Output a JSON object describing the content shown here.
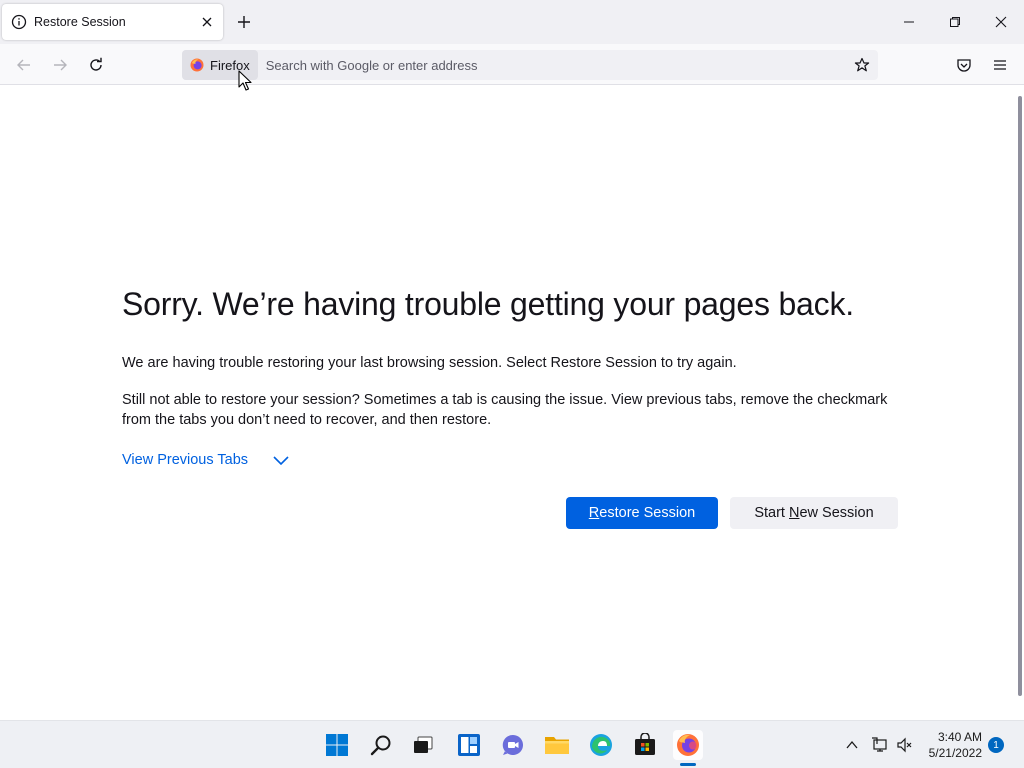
{
  "tab": {
    "title": "Restore Session"
  },
  "urlbar": {
    "identity_label": "Firefox",
    "placeholder": "Search with Google or enter address"
  },
  "content": {
    "title": "Sorry. We’re having trouble getting your pages back.",
    "para1": "We are having trouble restoring your last browsing session. Select Restore Session to try again.",
    "para2": "Still not able to restore your session? Sometimes a tab is causing the issue. View previous tabs, remove the checkmark from the tabs you don’t need to recover, and then restore.",
    "view_previous": "View Previous Tabs",
    "restore_btn": {
      "accesskey": "R",
      "rest": "estore Session"
    },
    "new_session_btn": {
      "before": "Start ",
      "accesskey": "N",
      "after": "ew Session"
    }
  },
  "taskbar": {
    "apps": [
      "start-icon",
      "search-icon",
      "task-view-icon",
      "widgets-icon",
      "chat-icon",
      "file-explorer-icon",
      "edge-icon",
      "store-icon",
      "firefox-icon"
    ],
    "time": "3:40 AM",
    "date": "5/21/2022",
    "notifications": "1"
  },
  "colors": {
    "accent": "#0061e0",
    "tab_strip": "#f0f0f4",
    "taskbar_accent": "#0067c0"
  }
}
